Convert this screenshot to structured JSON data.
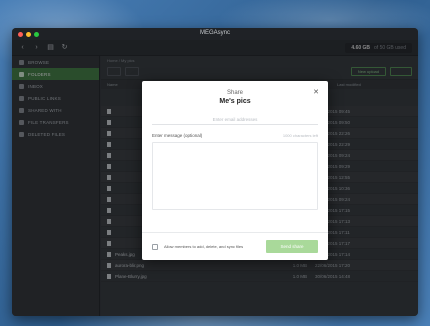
{
  "app": {
    "window_title": "MEGAsync"
  },
  "toolbar": {
    "back_icon": "chevron-left-icon",
    "grid_icon": "grid-icon",
    "refresh_icon": "refresh-icon",
    "storage_used": "4.60 GB",
    "storage_of": "of 50 GB used"
  },
  "sidebar": {
    "items": [
      {
        "label": "BROWSE",
        "active": false
      },
      {
        "label": "FOLDERS",
        "active": true
      },
      {
        "label": "INBOX",
        "active": false
      },
      {
        "label": "PUBLIC LINKS",
        "active": false
      },
      {
        "label": "SHARED WITH",
        "active": false
      },
      {
        "label": "FILE TRANSFERS",
        "active": false
      },
      {
        "label": "DELETED FILES",
        "active": false
      }
    ]
  },
  "main": {
    "breadcrumb": "Home  /  My pics",
    "new_folder_label": "New upload",
    "columns": {
      "name": "Name",
      "size": "Size",
      "date": "Last modified"
    },
    "rows": [
      {
        "name": "",
        "size": "",
        "date": "09/06/2015 09:45"
      },
      {
        "name": "",
        "size": "",
        "date": "10/06/2015 09:50"
      },
      {
        "name": "",
        "size": "",
        "date": "10/06/2015 22:26"
      },
      {
        "name": "",
        "size": "",
        "date": "10/06/2015 22:29"
      },
      {
        "name": "",
        "size": "",
        "date": "10/06/2015 09:24"
      },
      {
        "name": "",
        "size": "",
        "date": "10/06/2015 09:29"
      },
      {
        "name": "",
        "size": "",
        "date": "17/06/2015 12:55"
      },
      {
        "name": "",
        "size": "",
        "date": "19/06/2015 10:36"
      },
      {
        "name": "",
        "size": "",
        "date": "21/06/2015 09:24"
      },
      {
        "name": "",
        "size": "",
        "date": "21/06/2015 17:15"
      },
      {
        "name": "",
        "size": "",
        "date": "17/06/2015 17:13"
      },
      {
        "name": "",
        "size": "",
        "date": "22/06/2015 17:11"
      },
      {
        "name": "",
        "size": "",
        "date": "22/06/2015 17:17"
      },
      {
        "name": "Peaks.jpg",
        "size": "186.6 KB",
        "date": "22/06/2015 17:14"
      },
      {
        "name": "aurora-blir.png",
        "size": "1.0 MB",
        "date": "22/06/2015 17:20"
      },
      {
        "name": "Plane-Blurry.jpg",
        "size": "1.0 MB",
        "date": "30/06/2015 14:48"
      }
    ]
  },
  "dialog": {
    "title": "Share",
    "subtitle": "Me's pics",
    "email_placeholder": "Enter email addresses",
    "message_label": "Enter message (optional)",
    "message_count": "1000 characters left",
    "allow_text": "Allow members to add, delete, and sync files",
    "send_label": "Send share",
    "close_icon": "close-icon"
  },
  "colors": {
    "accent_green": "#3c7a3c",
    "send_button": "#a9d99a",
    "background": "#3d6fa1"
  }
}
